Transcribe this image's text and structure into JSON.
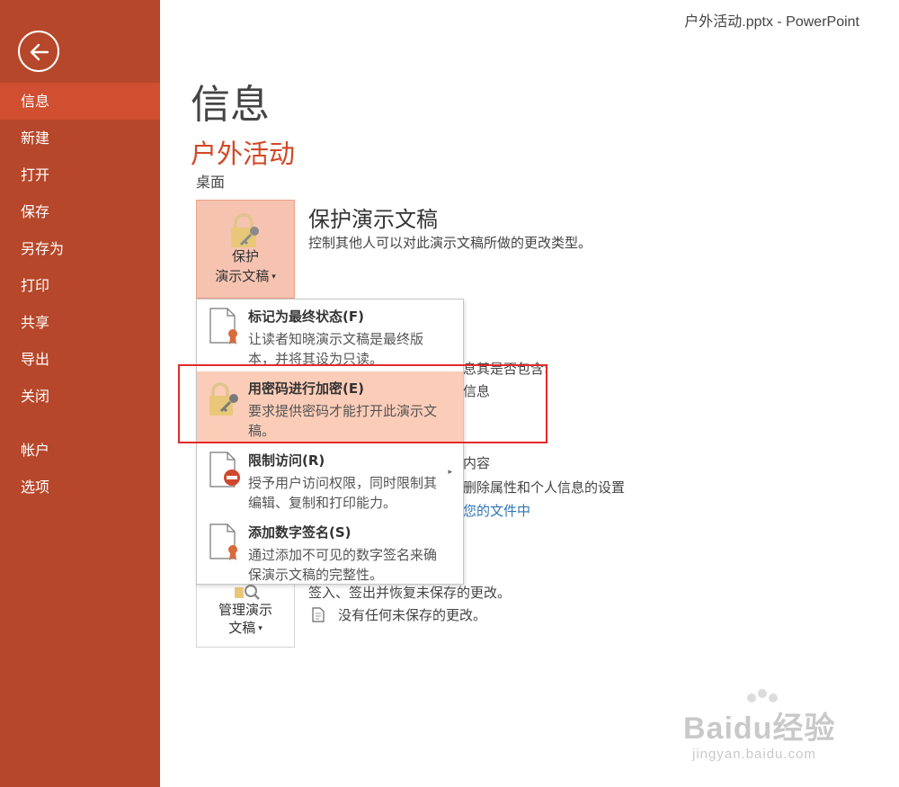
{
  "window": {
    "title": "户外活动.pptx - PowerPoint"
  },
  "sidebar": {
    "items": [
      {
        "label": "信息",
        "active": true
      },
      {
        "label": "新建"
      },
      {
        "label": "打开"
      },
      {
        "label": "保存"
      },
      {
        "label": "另存为"
      },
      {
        "label": "打印"
      },
      {
        "label": "共享"
      },
      {
        "label": "导出"
      },
      {
        "label": "关闭"
      },
      {
        "label": "帐户"
      },
      {
        "label": "选项"
      }
    ],
    "back_icon": "arrow-left-icon"
  },
  "main": {
    "page_title": "信息",
    "doc_name": "户外活动",
    "doc_location": "桌面",
    "protect": {
      "button_line1": "保护",
      "button_line2": "演示文稿",
      "title": "保护演示文稿",
      "description": "控制其他人可以对此演示文稿所做的更改类型。"
    },
    "manage": {
      "button_line1": "管理演示",
      "button_line2": "文稿",
      "line1": "签入、签出并恢复未保存的更改。",
      "line2": "没有任何未保存的更改。"
    },
    "partial_background": {
      "t1": "息其是否包含:",
      "t2": "信息",
      "t3": "内容",
      "t4": "删除属性和个人信息的设置",
      "t5": "您的文件中"
    }
  },
  "dropdown": {
    "items": [
      {
        "title": "标记为最终状态(F)",
        "description": "让读者知晓演示文稿是最终版本，并将其设为只读。"
      },
      {
        "title": "用密码进行加密(E)",
        "description": "要求提供密码才能打开此演示文稿。",
        "highlighted": true
      },
      {
        "title": "限制访问(R)",
        "description": "授予用户访问权限，同时限制其编辑、复制和打印能力。",
        "has_submenu": true
      },
      {
        "title": "添加数字签名(S)",
        "description": "通过添加不可见的数字签名来确保演示文稿的完整性。"
      }
    ]
  },
  "watermark": {
    "main": "Baidu经验",
    "sub": "jingyan.baidu.com"
  },
  "colors": {
    "sidebar": "#b7472a",
    "sidebar_active": "#d04f31",
    "accent": "#d24726",
    "highlight": "#fbcdb8",
    "annotation_box": "#e22b2b"
  }
}
